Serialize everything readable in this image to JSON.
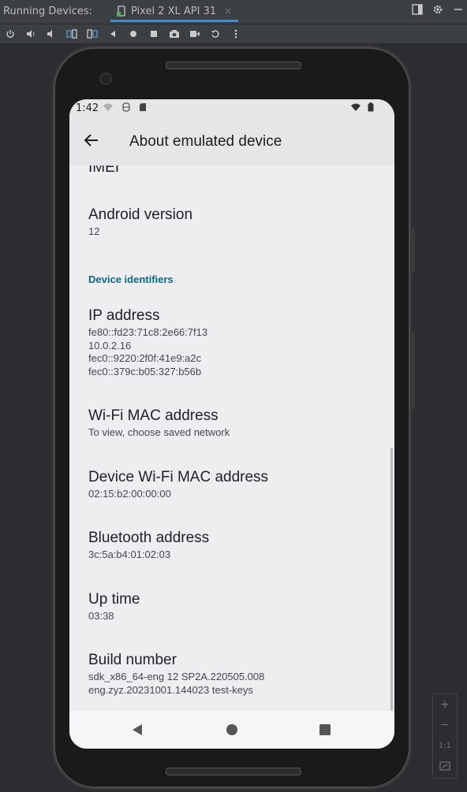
{
  "ide": {
    "panel_title": "Running Devices:",
    "tab_label": "Pixel 2 XL API 31",
    "tab_close": "×",
    "toolbar_icons": [
      "power-icon",
      "volume-up-icon",
      "volume-down-icon",
      "rotate-left-icon",
      "rotate-right-icon",
      "back-icon",
      "home-icon",
      "overview-icon",
      "screenshot-icon",
      "screen-record-icon",
      "reset-icon",
      "more-icon"
    ],
    "header_icons": [
      "layout-icon",
      "gear-icon",
      "minimize-icon"
    ]
  },
  "device": {
    "status": {
      "time": "1:42"
    },
    "appbar": {
      "title": "About emulated device"
    },
    "items": [
      {
        "title": "IMEI"
      },
      {
        "title": "Android version",
        "sub": "12"
      },
      {
        "section": "Device identifiers"
      },
      {
        "title": "IP address",
        "sub_lines": [
          "fe80::fd23:71c8:2e66:7f13",
          "10.0.2.16",
          "fec0::9220:2f0f:41e9:a2c",
          "fec0::379c:b05:327:b56b"
        ]
      },
      {
        "title": "Wi-Fi MAC address",
        "sub": "To view, choose saved network"
      },
      {
        "title": "Device Wi-Fi MAC address",
        "sub": "02:15:b2:00:00:00"
      },
      {
        "title": "Bluetooth address",
        "sub": "3c:5a:b4:01:02:03"
      },
      {
        "title": "Up time",
        "sub": "03:38"
      },
      {
        "title": "Build number",
        "sub_lines": [
          "sdk_x86_64-eng 12 SP2A.220505.008",
          "eng.zyz.20231001.144023 test-keys"
        ]
      }
    ]
  },
  "zoom_panel": {
    "zoom_in": "+",
    "zoom_out": "−",
    "actual_size": "1:1"
  },
  "colors": {
    "accent": "#4a88c7",
    "section": "#0b6884",
    "screen_bg": "#eeeef1"
  }
}
